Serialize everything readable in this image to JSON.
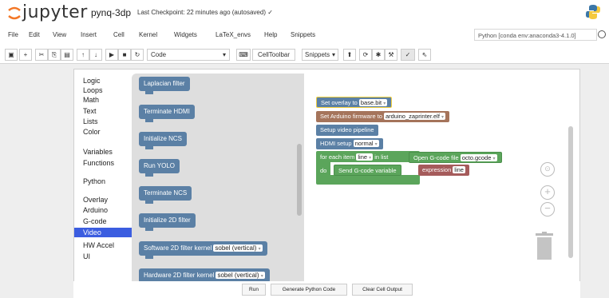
{
  "header": {
    "logo_text": "jupyter",
    "notebook_name": "pynq-3dp",
    "checkpoint": "Last Checkpoint: 22 minutes ago (autosaved) ✓"
  },
  "menubar": {
    "items": [
      "File",
      "Edit",
      "View",
      "Insert",
      "Cell",
      "Kernel",
      "Widgets",
      "LaTeX_envs",
      "Help",
      "Snippets"
    ],
    "kernel": "Python [conda env:anaconda3-4.1.0]"
  },
  "toolbar": {
    "cell_type": "Code",
    "celltoolbar_label": "CellToolbar",
    "snippets_label": "Snippets"
  },
  "blockly": {
    "categories": [
      "Logic",
      "Loops",
      "Math",
      "Text",
      "Lists",
      "Color",
      "Variables",
      "Functions",
      "Python",
      "Overlay",
      "Arduino",
      "G-code",
      "Video",
      "HW Accel",
      "UI"
    ],
    "selected_category": "Video",
    "flyout_blocks": [
      "Laplacian filter",
      "Terminate HDMI",
      "Initialize NCS",
      "Run YOLO",
      "Terminate NCS",
      "Initialize 2D filter",
      "Software 2D filter kernel",
      "Hardware 2D filter kernel"
    ],
    "kernel_value_software": "sobel (vertical)",
    "kernel_value_hardware": "sobel (vertical)",
    "workspace": {
      "set_overlay_label": "Set overlay to",
      "set_overlay_value": "base.bit",
      "set_arduino_label": "Set Arduino firmware to",
      "set_arduino_value": "arduino_zaprinter.elf",
      "setup_video": "Setup video pipeline",
      "hdmi_setup_label": "HDMI setup",
      "hdmi_setup_value": "normal",
      "for_each_label": "for each item",
      "for_each_var": "line",
      "in_list_label": "in list",
      "open_gcode_label": "Open G-code file",
      "open_gcode_value": "octo.gcode",
      "do_label": "do",
      "send_gcode_label": "Send G-code variable",
      "expression_label": "expression",
      "expression_value": "line"
    },
    "colors": {
      "flyout_block": "#5b80a5",
      "overlay_block": "#5b80a5",
      "arduino_block": "#a5745b",
      "loop_block": "#5ba55b",
      "send_block": "#a55b5b",
      "selected_category": "#3b5de0"
    }
  },
  "buttons": {
    "run": "Run",
    "generate": "Generate Python Code",
    "clear": "Clear Cell Output"
  }
}
